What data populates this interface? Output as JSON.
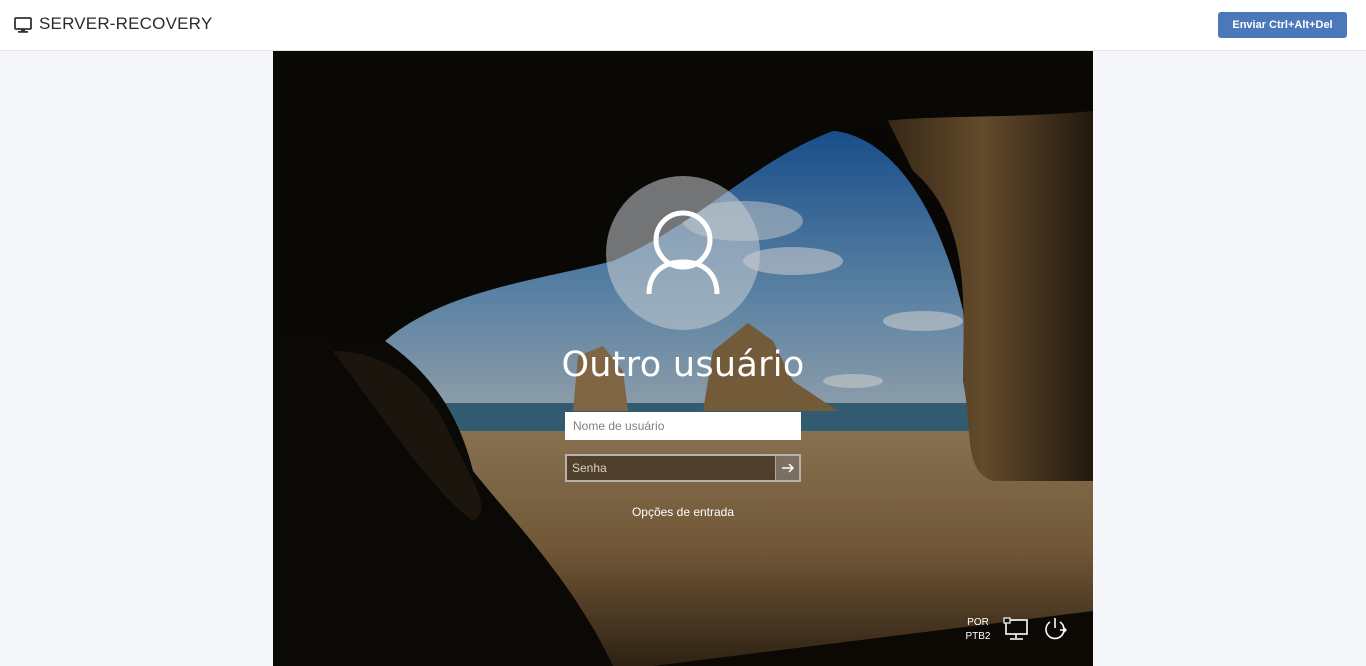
{
  "header": {
    "icon": "monitor-icon",
    "title": "SERVER-RECOVERY",
    "cad_button_label": "Enviar Ctrl+Alt+Del"
  },
  "login": {
    "avatar_icon": "user-icon",
    "user_title": "Outro usuário",
    "username_placeholder": "Nome de usuário",
    "username_value": "",
    "password_placeholder": "Senha",
    "password_value": "",
    "submit_icon": "arrow-right-icon",
    "signin_options": "Opções de entrada"
  },
  "tray": {
    "lang_line1": "POR",
    "lang_line2": "PTB2",
    "network_icon": "network-icon",
    "power_icon": "power-icon"
  },
  "colors": {
    "accent": "#4a78b8",
    "page_bg": "#f6f7fb"
  }
}
